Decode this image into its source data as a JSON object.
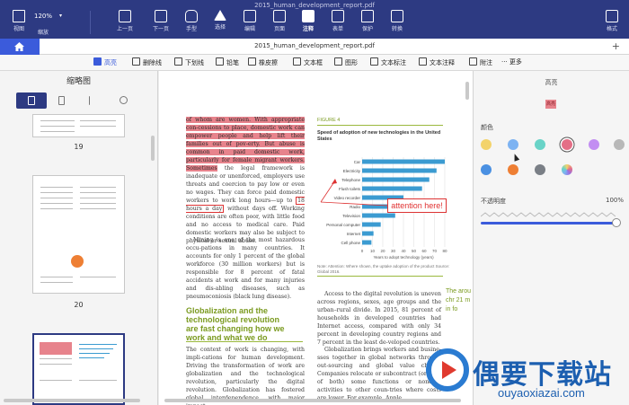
{
  "window": {
    "title": "2015_human_development_report.pdf"
  },
  "topbar": {
    "zoom_value": "120%",
    "buttons": [
      {
        "label": "视图"
      },
      {
        "label": "上一页"
      },
      {
        "label": "下一页"
      },
      {
        "label": "手型"
      },
      {
        "label": "选择"
      },
      {
        "label": "编辑"
      },
      {
        "label": "页面"
      },
      {
        "label": "注释"
      },
      {
        "label": "表单"
      },
      {
        "label": "保护"
      },
      {
        "label": "转换"
      },
      {
        "label": "格式"
      }
    ],
    "zoom_label": "缩放"
  },
  "tabbar": {
    "doc_title": "2015_human_development_report.pdf",
    "add": "+"
  },
  "annotation_tools": [
    {
      "label": "高亮",
      "active": true
    },
    {
      "label": "删除线"
    },
    {
      "label": "下划线"
    },
    {
      "label": "铅笔"
    },
    {
      "label": "橡皮擦"
    },
    {
      "label": "文本框"
    },
    {
      "label": "图形"
    },
    {
      "label": "文本标注"
    },
    {
      "label": "文本注释"
    },
    {
      "label": "附注"
    },
    {
      "label": "更多"
    }
  ],
  "thumbnail_panel": {
    "title": "缩略图",
    "pages": [
      "19",
      "20"
    ]
  },
  "document": {
    "left_col_highlighted": "of whom are women. With appropriate con-cessions to place, domestic work can empower people and help lift their families out of pov-erty. But abuse is common in paid domestic work, particularly for female migrant workers. Sometimes",
    "left_col_text_a": " the legal framework is inadequate or unenforced, employers use threats and coercion to pay low or even no wages. They can force paid domestic workers to work long hours—up to ",
    "left_col_boxed": "18 hours a day",
    "left_col_text_b": " without days off. Working conditions are often poor, with little food and no access to medical care. Paid domestic workers may also be subject to physical or sexual abuse.",
    "left_col_para2": "Mining is one of the most hazardous occu-pations in many countries. It accounts for only 1 percent of the global workforce (30 million workers) but is responsible for 8 percent of fatal accidents at work and for many injuries and dis-abling diseases, such as pneumoconiosis (black lung disease).",
    "section_heading": "Globalization and the technological revolution are fast changing how we work and what we do",
    "left_col_para3": "The context of work is changing, with impli-cations for human development. Driving the transformation of work are globalization and the technological revolution, particularly the digital revolution. Globalization has fostered global interdependence, with major impact",
    "figure_label": "FIGURE 4",
    "figure_title": "Speed of adoption of new technologies in the United States",
    "figure_note": "Note: Attention: Where shown, the uptake adoption of the product Source: Global 2016.",
    "right_col_para1": "Access to the digital revolution is uneven across regions, sexes, age groups and the urban–rural divide. In 2015, 81 percent of households in developed countries had Internet access, compared with only 34 percent in developing country regions and 7 percent in the least de-veloped countries.",
    "right_col_para2": "Globalization brings workers and busine-sses together in global networks through out-sourcing and global value chains. Companies relocate or subcontract (or a bit of both) some functions or noncore activities to other coun-tries where costs are lower. For example, Apple",
    "callout_text": "attention here!",
    "side_page_text": "The arou chr 21 m in fo"
  },
  "chart_data": {
    "type": "bar",
    "orientation": "horizontal",
    "categories": [
      "Car",
      "Electricity",
      "Telephone",
      "Flush toilets",
      "Video recorder",
      "Radio",
      "Television",
      "Personal computer",
      "Internet",
      "Cell phone"
    ],
    "values": [
      80,
      72,
      65,
      58,
      40,
      38,
      32,
      18,
      11,
      9
    ],
    "xlabel": "Years to adopt technology (years)",
    "xlim": [
      0,
      80
    ],
    "xticks": [
      "0",
      "10",
      "20",
      "30",
      "40",
      "50",
      "60",
      "70",
      "80"
    ],
    "color": "#3b9bd1"
  },
  "properties_panel": {
    "title": "高亮",
    "preview_text": "高亮",
    "color_label": "颜色",
    "colors": [
      "#f3d36b",
      "#7db3f2",
      "#69d3c7",
      "#e46f86",
      "#c28ef2",
      "#b8b8b8",
      "#4a90e2",
      "#ee7f34",
      "#7a7f86",
      "#9b6fe0"
    ],
    "selected_color_index": 3,
    "opacity_label": "不透明度",
    "opacity_value": "100%",
    "opacity_fraction": 1.0
  },
  "watermark": {
    "cn": "偶要下载站",
    "en": "ouyaoxiazai.com"
  }
}
